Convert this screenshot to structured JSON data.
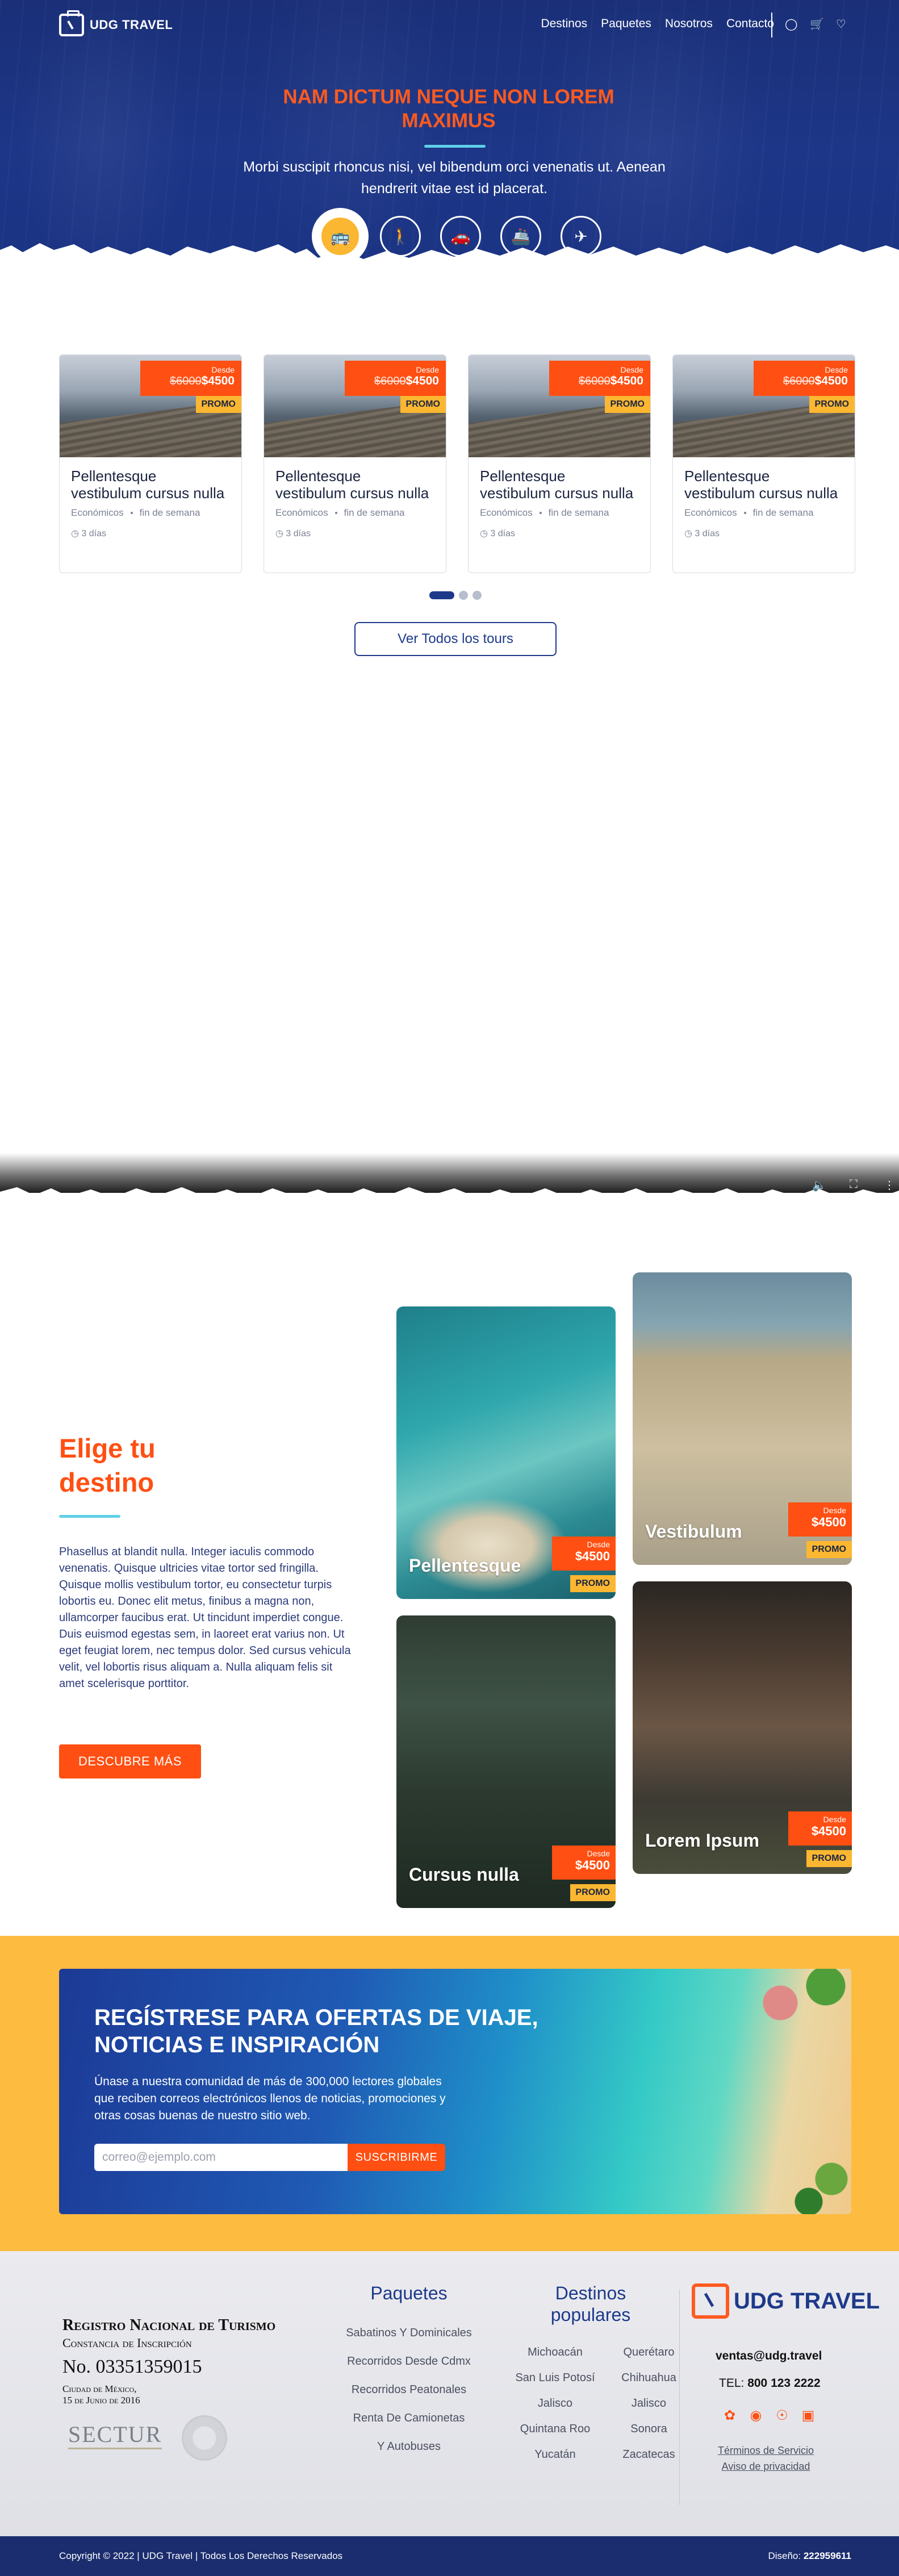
{
  "header": {
    "brand": "UDG TRAVEL",
    "nav": [
      "Destinos",
      "Paquetes",
      "Nosotros",
      "Contacto"
    ],
    "icons": [
      "user-icon",
      "cart-icon",
      "heart-icon"
    ]
  },
  "hero": {
    "title": "NAM DICTUM NEQUE NON LOREM MAXIMUS",
    "subtitle": "Morbi suscipit rhoncus nisi, vel bibendum orci venenatis ut. Aenean hendrerit vitae est id placerat.",
    "categories": [
      "bus-icon",
      "hiking-icon",
      "car-icon",
      "ship-icon",
      "plane-icon"
    ],
    "active_category": 0
  },
  "tours": {
    "items": [
      {
        "title": "Pellentesque vestibulum cursus nulla",
        "desde": "Desde",
        "old_price": "$6000",
        "price": "$4500",
        "promo": "PROMO",
        "tag1": "Económicos",
        "tag2": "fin de semana",
        "days": "3 días"
      },
      {
        "title": "Pellentesque vestibulum cursus nulla",
        "desde": "Desde",
        "old_price": "$6000",
        "price": "$4500",
        "promo": "PROMO",
        "tag1": "Económicos",
        "tag2": "fin de semana",
        "days": "3 días"
      },
      {
        "title": "Pellentesque vestibulum cursus nulla",
        "desde": "Desde",
        "old_price": "$6000",
        "price": "$4500",
        "promo": "PROMO",
        "tag1": "Económicos",
        "tag2": "fin de semana",
        "days": "3 días"
      },
      {
        "title": "Pellentesque vestibulum cursus nulla",
        "desde": "Desde",
        "old_price": "$6000",
        "price": "$4500",
        "promo": "PROMO",
        "tag1": "Económicos",
        "tag2": "fin de semana",
        "days": "3 días"
      }
    ],
    "carousel_pages": 3,
    "carousel_active": 0,
    "all_button": "Ver Todos los tours"
  },
  "destinos": {
    "title": "Elige tu destino",
    "text": "Phasellus at blandit nulla. Integer iaculis commodo venenatis. Quisque ultricies vitae tortor sed fringilla. Quisque mollis vestibulum tortor, eu consectetur turpis lobortis eu. Donec elit metus, finibus a magna non, ullamcorper faucibus erat. Ut tincidunt imperdiet congue. Duis euismod egestas sem, in laoreet erat varius non. Ut eget feugiat lorem, nec tempus dolor. Sed cursus vehicula velit, vel lobortis risus aliquam a. Nulla aliquam felis sit amet scelerisque porttitor.",
    "button": "DESCUBRE MÁS",
    "cards": [
      {
        "name": "Pellentesque",
        "desde": "Desde",
        "price": "$4500",
        "promo": "PROMO"
      },
      {
        "name": "Vestibulum",
        "desde": "Desde",
        "price": "$4500",
        "promo": "PROMO"
      },
      {
        "name": "Cursus nulla",
        "desde": "Desde",
        "price": "$4500",
        "promo": "PROMO"
      },
      {
        "name": "Lorem Ipsum",
        "desde": "Desde",
        "price": "$4500",
        "promo": "PROMO"
      }
    ]
  },
  "newsletter": {
    "title": "REGÍSTRESE PARA OFERTAS DE VIAJE, NOTICIAS E INSPIRACIÓN",
    "text": "Únase a nuestra comunidad de más de 300,000 lectores globales que reciben correos electrónicos llenos de noticias, promociones y otras cosas buenas de nuestro sitio web.",
    "placeholder": "correo@ejemplo.com",
    "button": "SUSCRIBIRME"
  },
  "footer": {
    "registro": {
      "line1": "Registro Nacional de Turismo",
      "line2": "Constancia de Inscripción",
      "number": "No. 03351359015",
      "city": "Ciudad de México,",
      "date": "15 de Junio de 2016",
      "sectur": "SECTUR"
    },
    "paquetes": {
      "title": "Paquetes",
      "items": [
        "Sabatinos Y Dominicales",
        "Recorridos Desde Cdmx",
        "Recorridos Peatonales",
        "Renta De Camionetas",
        "Y Autobuses"
      ]
    },
    "destinos": {
      "title": "Destinos populares",
      "items": [
        "Michoacán",
        "Querétaro",
        "San Luis Potosí",
        "Chihuahua",
        "Jalisco",
        "Jalisco",
        "Quintana Roo",
        "Sonora",
        "Yucatán",
        "Zacatecas"
      ]
    },
    "contact": {
      "brand": "UDG TRAVEL",
      "email": "ventas@udg.travel",
      "tel_label": "TEL:",
      "tel": "800 123 2222",
      "social": [
        "twitter-icon",
        "facebook-icon",
        "pinterest-icon",
        "instagram-icon"
      ],
      "terms": "Términos de Servicio",
      "privacy": "Aviso de privacidad"
    },
    "copyright": "Copyright © 2022   |   UDG Travel   |   Todos Los Derechos Reservados",
    "design_label": "Diseño:",
    "design_value": "222959611"
  },
  "colors": {
    "primary_blue": "#1d3a8a",
    "accent_orange": "#ff4f12",
    "promo_yellow": "#fbb731",
    "accent_cyan": "#5fd0e8"
  }
}
